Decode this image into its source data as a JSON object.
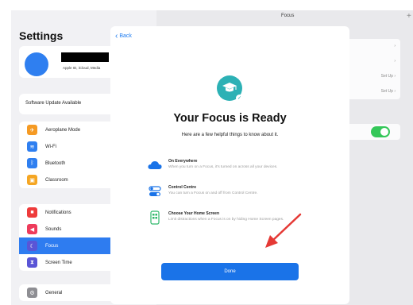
{
  "sidebar": {
    "title": "Settings",
    "account_subtitle": "Apple ID, iCloud, Media",
    "software_update": "Software Update Available",
    "group1": [
      {
        "label": "Aeroplane Mode",
        "color": "#f59a23",
        "icon": "airplane-icon"
      },
      {
        "label": "Wi-Fi",
        "color": "#2f7ff0",
        "icon": "wifi-icon"
      },
      {
        "label": "Bluetooth",
        "color": "#2f7ff0",
        "icon": "bluetooth-icon"
      },
      {
        "label": "Classroom",
        "color": "#f5a623",
        "icon": "classroom-icon"
      }
    ],
    "group2": [
      {
        "label": "Notifications",
        "color": "#ee3b3b",
        "icon": "notifications-icon"
      },
      {
        "label": "Sounds",
        "color": "#ee3b5b",
        "icon": "sounds-icon"
      },
      {
        "label": "Focus",
        "color": "#5a55d6",
        "icon": "moon-icon",
        "selected": true
      },
      {
        "label": "Screen Time",
        "color": "#5a55d6",
        "icon": "hourglass-icon"
      }
    ],
    "group3": [
      {
        "label": "General",
        "color": "#8e8e93",
        "icon": "gear-icon"
      }
    ]
  },
  "detail": {
    "title": "Focus",
    "setup1": "Set Up",
    "setup2": "Set Up",
    "devices": "evices."
  },
  "modal": {
    "back_label": "Back",
    "title": "Your Focus is Ready",
    "subtitle": "Here are a few helpful things to know about it.",
    "features": [
      {
        "title": "On Everywhere",
        "desc": "When you turn on a Focus, it's turned on across all your devices.",
        "icon": "cloud-icon"
      },
      {
        "title": "Control Centre",
        "desc": "You can turn a Focus on and off from Control Centre.",
        "icon": "toggle-icon"
      },
      {
        "title": "Choose Your Home Screen",
        "desc": "Limit distractions when a Focus is on by hiding Home Screen pages.",
        "icon": "phone-icon"
      }
    ],
    "done_label": "Done"
  },
  "colors": {
    "accent": "#1a73e8",
    "focus_badge": "#2cb1b5",
    "toggle_on": "#34c759",
    "arrow": "#e53935"
  }
}
